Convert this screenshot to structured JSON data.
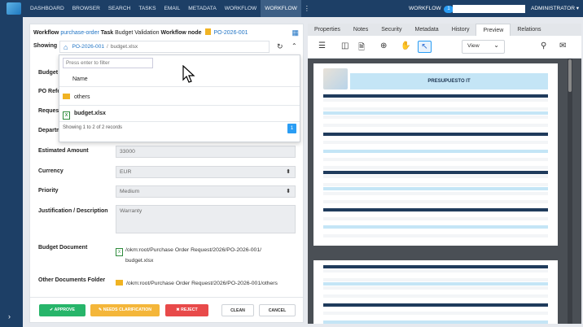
{
  "nav": {
    "items": [
      "DASHBOARD",
      "BROWSER",
      "SEARCH",
      "TASKS",
      "EMAIL",
      "METADATA",
      "WORKFLOW",
      "WORKFLOW"
    ],
    "active_index": 7,
    "workflow_label": "WORKFLOW",
    "workflow_count": "1",
    "user": "ADMINISTRATOR ▾"
  },
  "form": {
    "workflow_label": "Workflow",
    "workflow_value": "purchase-order",
    "task_label": "Task",
    "task_value": "Budget Validation",
    "node_label": "Workflow node",
    "node_value": "PO-2026-001",
    "showing_label": "Showing",
    "crumb1": "PO-2026-001",
    "crumb_sep": "/",
    "crumb2": "budget.xlsx",
    "fields": [
      {
        "label": "Budget T",
        "value": ""
      },
      {
        "label": "PO Refe",
        "value": ""
      },
      {
        "label": "Request",
        "value": ""
      },
      {
        "label": "Departm",
        "value": ""
      },
      {
        "label": "Estimated Amount",
        "value": "33000"
      },
      {
        "label": "Currency",
        "value": "EUR"
      },
      {
        "label": "Priority",
        "value": "Medium"
      },
      {
        "label": "Justification / Description",
        "value": "Warranty"
      },
      {
        "label": "Budget Document",
        "value": ""
      },
      {
        "label": "Other Documents Folder",
        "value": ""
      }
    ],
    "budget_doc_line1": "/okm:root/Purchase Order Request/2026/PO-2026-001/",
    "budget_doc_line2": "budget.xlsx",
    "other_docs": "/okm:root/Purchase Order Request/2026/PO-2026-001/others",
    "buttons": {
      "approve": "✔ APPROVE",
      "clarification": "✎ NEEDS CLARIFICATION",
      "reject": "✖ REJECT",
      "clean": "CLEAN",
      "cancel": "CANCEL"
    }
  },
  "popup": {
    "filter_placeholder": "Press enter to filter",
    "col_name": "Name",
    "rows": [
      "others",
      "budget.xlsx"
    ],
    "count": "Showing 1 to 2 of 2 records",
    "page": "1"
  },
  "tabs": [
    "Properties",
    "Notes",
    "Security",
    "Metadata",
    "History",
    "Preview",
    "Relations"
  ],
  "active_tab": 5,
  "preview": {
    "view_label": "View",
    "sheet_title": "PRESUPUESTO IT"
  },
  "colors": {
    "topbar": "#1d3f66",
    "accent": "#2a9df4",
    "approve": "#27b56a",
    "clarify": "#f4b63a",
    "reject": "#e84a4a"
  }
}
